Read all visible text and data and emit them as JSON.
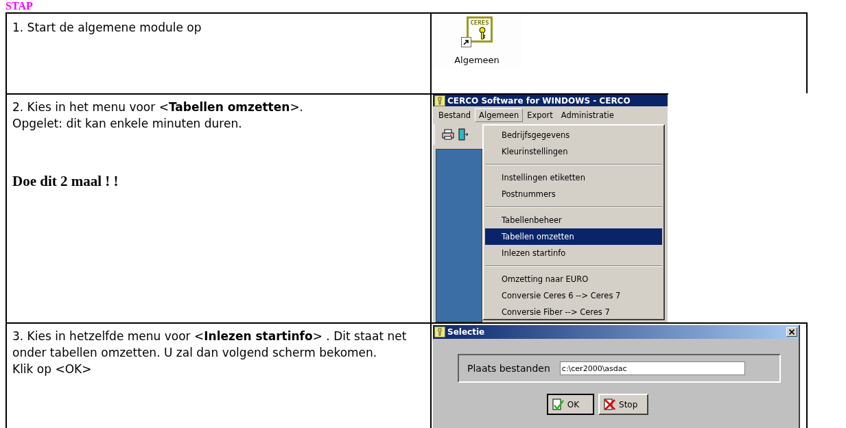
{
  "heading": "STAP",
  "steps": [
    {
      "kind": "icon",
      "lines": [
        "1. Start de algemene module op"
      ],
      "shortcut": {
        "logo": "CERES",
        "label": "Algemeen"
      }
    },
    {
      "kind": "menu",
      "lines": [
        "2. Kies in het menu voor <**Tabellen omzetten**>.",
        "Opgelet: dit kan enkele minuten duren."
      ],
      "emphasis": "Doe dit 2 maal ! !",
      "window": {
        "title": "CERCO Software for WINDOWS - CERCO",
        "menubar": [
          {
            "label": "Bestand",
            "selected": false
          },
          {
            "label": "Algemeen",
            "selected": true
          },
          {
            "label": "Export",
            "selected": false
          },
          {
            "label": "Administratie",
            "selected": false
          }
        ],
        "menu_groups": [
          [
            {
              "label": "Bedrijfsgegevens",
              "selected": false
            },
            {
              "label": "Kleurinstellingen",
              "selected": false
            }
          ],
          [
            {
              "label": "Instellingen etiketten",
              "selected": false
            },
            {
              "label": "Postnummers",
              "selected": false
            }
          ],
          [
            {
              "label": "Tabellenbeheer",
              "selected": false
            },
            {
              "label": "Tabellen omzetten",
              "selected": true
            },
            {
              "label": "Inlezen startinfo",
              "selected": false
            }
          ],
          [
            {
              "label": "Omzetting naar EURO",
              "selected": false
            },
            {
              "label": "Conversie Ceres 6 --> Ceres 7",
              "selected": false
            },
            {
              "label": "Conversie Fiber --> Ceres 7",
              "selected": false
            }
          ]
        ]
      }
    },
    {
      "kind": "dialog",
      "lines": [
        "3. Kies in hetzelfde menu voor <**Inlezen startinfo**> . Dit staat net onder tabellen omzetten. U zal dan volgend scherm bekomen.",
        "Klik op <OK>"
      ],
      "dialog": {
        "title": "Selectie",
        "field_label": "Plaats bestanden",
        "field_value": "c:\\cer2000\\asdac",
        "buttons": [
          {
            "label": "OK",
            "kind": "ok"
          },
          {
            "label": "Stop",
            "kind": "stop"
          }
        ]
      }
    }
  ]
}
